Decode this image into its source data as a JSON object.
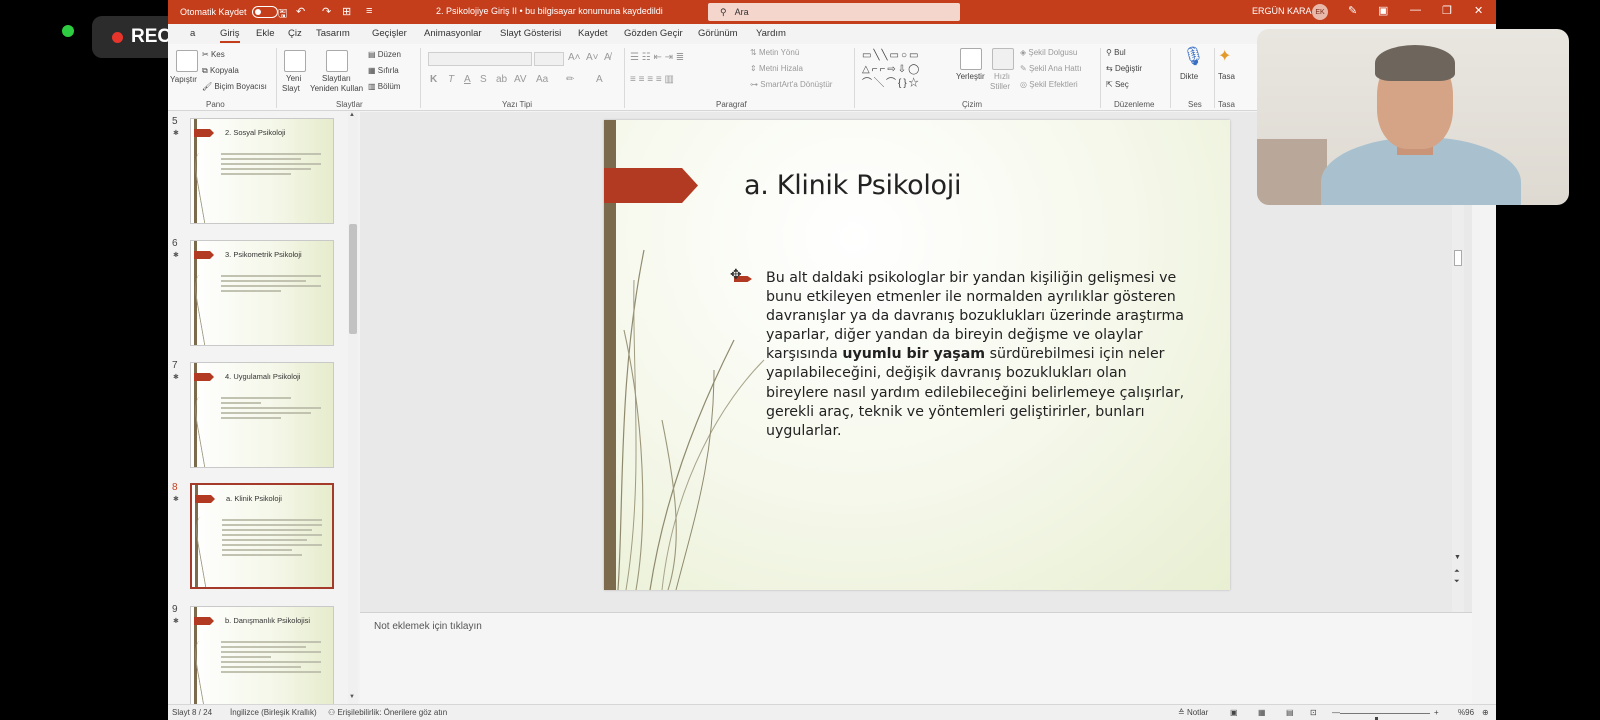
{
  "recorder": {
    "label": "REC"
  },
  "titlebar": {
    "autosave_label": "Otomatik Kaydet",
    "document_title": "2. Psikolojiye Giriş II  •  bu bilgisayar konumuna kaydedildi",
    "search_placeholder": "Ara",
    "user_name": "ERGÜN KARA",
    "user_initials": "EK"
  },
  "menu": {
    "items": [
      "a",
      "Giriş",
      "Ekle",
      "Çiz",
      "Tasarım",
      "Geçişler",
      "Animasyonlar",
      "Slayt Gösterisi",
      "Kaydet",
      "Gözden Geçir",
      "Görünüm",
      "Yardım"
    ],
    "active": "Giriş"
  },
  "ribbon": {
    "pano": {
      "label": "Pano",
      "paste": "Yapıştır",
      "cut": "Kes",
      "copy": "Kopyala",
      "format_painter": "Biçim Boyacısı"
    },
    "slaytlar": {
      "label": "Slaytlar",
      "new_slide": "Yeni",
      "new_slide_2": "Slayt",
      "reuse": "Slaytları",
      "reuse_2": "Yeniden Kullan",
      "layout": "Düzen",
      "reset": "Sıfırla",
      "section": "Bölüm"
    },
    "yazi_tipi": {
      "label": "Yazı Tipi",
      "bold": "K",
      "italic": "T",
      "underline": "A",
      "strike": "S",
      "case": "Aa"
    },
    "paragraf": {
      "label": "Paragraf",
      "text_direction": "Metin Yönü",
      "align_text": "Metni Hizala",
      "smartart": "SmartArt'a Dönüştür"
    },
    "cizim": {
      "label": "Çizim",
      "arrange": "Yerleştir",
      "quick_styles": "Hızlı",
      "quick_styles_2": "Stiller",
      "fill": "Şekil Dolgusu",
      "outline": "Şekil Ana Hattı",
      "effects": "Şekil Efektleri"
    },
    "duzenleme": {
      "label": "Düzenleme",
      "find": "Bul",
      "replace": "Değiştir",
      "select": "Seç"
    },
    "ses": {
      "label": "Ses",
      "dictate": "Dikte"
    },
    "tasarimci": {
      "label": "Tasa",
      "button": "Tasa"
    }
  },
  "thumbnails": [
    {
      "number": "5",
      "title": "2. Sosyal Psikoloji",
      "selected": false
    },
    {
      "number": "6",
      "title": "3. Psikometrik Psikoloji",
      "selected": false
    },
    {
      "number": "7",
      "title": "4. Uygulamalı Psikoloji",
      "selected": false
    },
    {
      "number": "8",
      "title": "a. Klinik Psikoloji",
      "selected": true
    },
    {
      "number": "9",
      "title": "b. Danışmanlık Psikolojisi",
      "selected": false
    }
  ],
  "slide": {
    "title": "a. Klinik Psikoloji",
    "body_part1": "Bu alt daldaki psikologlar bir yandan kişiliğin gelişmesi ve bunu etkileyen etmenler ile normalden ayrılıklar gösteren davranışlar ya da davranış bozuklukları üzerinde araştırma yaparlar, diğer yandan da bireyin değişme ve olaylar karşısında ",
    "body_bold": "uyumlu bir yaşam",
    "body_part2": " sürdürebilmesi için neler yapılabileceğini, değişik davranış bozuklukları olan bireylere nasıl yardım edilebileceğini belirlemeye çalışırlar, gerekli araç, teknik ve yöntemleri geliştirirler, bunları uygularlar."
  },
  "notes": {
    "placeholder": "Not eklemek için tıklayın"
  },
  "status": {
    "slide_counter": "Slayt 8 / 24",
    "language": "İngilizce (Birleşik Krallık)",
    "accessibility": "Erişilebilirlik: Önerilere göz atın",
    "notes_button": "Notlar",
    "zoom": "%96",
    "zoom_fraction": 0.4
  },
  "colors": {
    "accent": "#c43e1c",
    "slide_accent": "#b23a22",
    "slide_bar": "#7b6a4c"
  }
}
